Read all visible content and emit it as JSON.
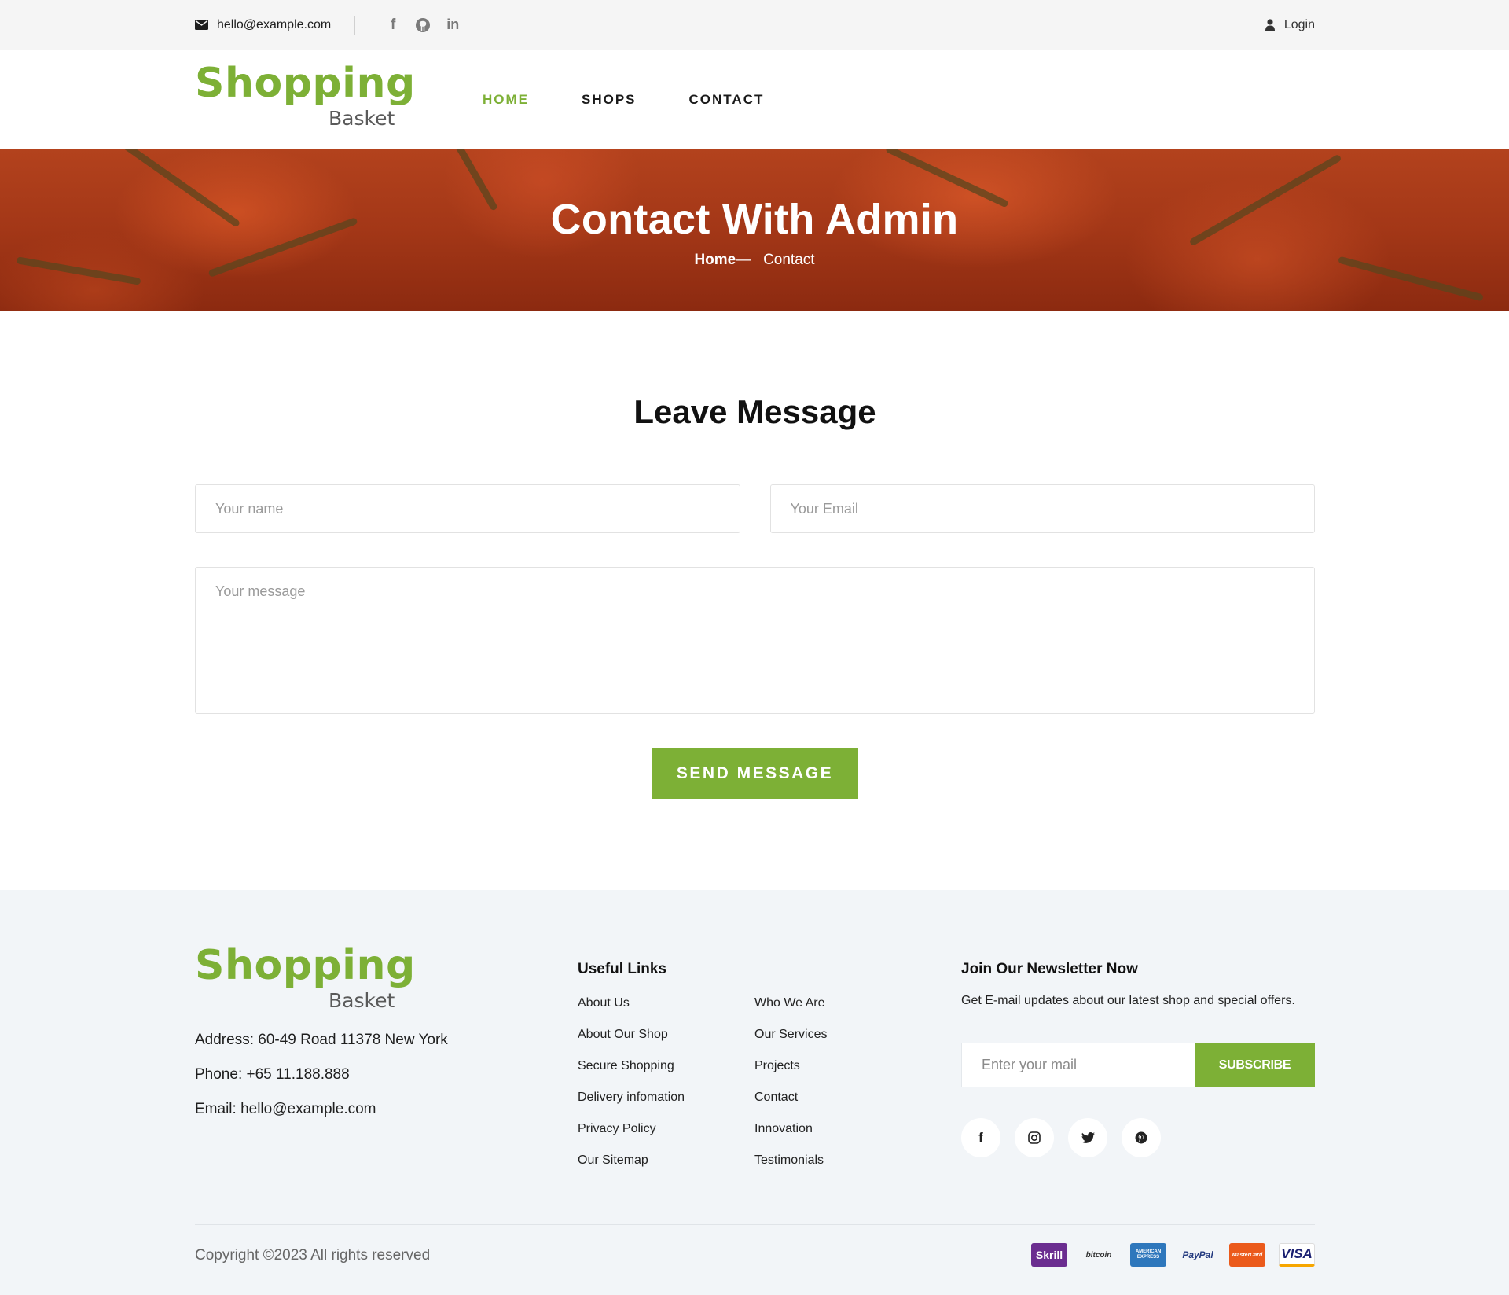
{
  "topbar": {
    "email": "hello@example.com",
    "social_icons": [
      "facebook-icon",
      "github-icon",
      "linkedin-icon"
    ],
    "login_label": "Login"
  },
  "header": {
    "logo_main": "Shopping",
    "logo_sub": "Basket",
    "nav": [
      {
        "label": "HOME",
        "active": true
      },
      {
        "label": "SHOPS",
        "active": false
      },
      {
        "label": "CONTACT",
        "active": false
      }
    ]
  },
  "banner": {
    "title": "Contact With Admin",
    "breadcrumb_home": "Home",
    "breadcrumb_sep": "—",
    "breadcrumb_current": "Contact"
  },
  "contact_form": {
    "title": "Leave Message",
    "name_placeholder": "Your name",
    "email_placeholder": "Your Email",
    "message_placeholder": "Your message",
    "submit_label": "SEND MESSAGE"
  },
  "footer": {
    "logo_main": "Shopping",
    "logo_sub": "Basket",
    "address": "Address: 60-49 Road 11378 New York",
    "phone": "Phone: +65 11.188.888",
    "email": "Email: hello@example.com",
    "links_title": "Useful Links",
    "links_col1": [
      "About Us",
      "About Our Shop",
      "Secure Shopping",
      "Delivery infomation",
      "Privacy Policy",
      "Our Sitemap"
    ],
    "links_col2": [
      "Who We Are",
      "Our Services",
      "Projects",
      "Contact",
      "Innovation",
      "Testimonials"
    ],
    "newsletter_title": "Join Our Newsletter Now",
    "newsletter_text": "Get E-mail updates about our latest shop and special offers.",
    "newsletter_placeholder": "Enter your mail",
    "subscribe_label": "SUBSCRIBE",
    "social_icons": [
      "facebook-icon",
      "instagram-icon",
      "twitter-icon",
      "pinterest-icon"
    ],
    "copyright": "Copyright ©2023 All rights reserved",
    "payments": [
      {
        "name": "Skrill",
        "color": "#6b2d90"
      },
      {
        "name": "bitcoin",
        "color": "#f7931a"
      },
      {
        "name": "AMERICAN EXPRESS",
        "color": "#2e77bc"
      },
      {
        "name": "PayPal",
        "color": "#253b80"
      },
      {
        "name": "MasterCard",
        "color": "#eb001b"
      },
      {
        "name": "VISA",
        "color": "#1a1f71"
      }
    ]
  },
  "colors": {
    "accent": "#7db036",
    "footer_bg": "#f2f5f8",
    "topbar_bg": "#f5f5f5"
  }
}
